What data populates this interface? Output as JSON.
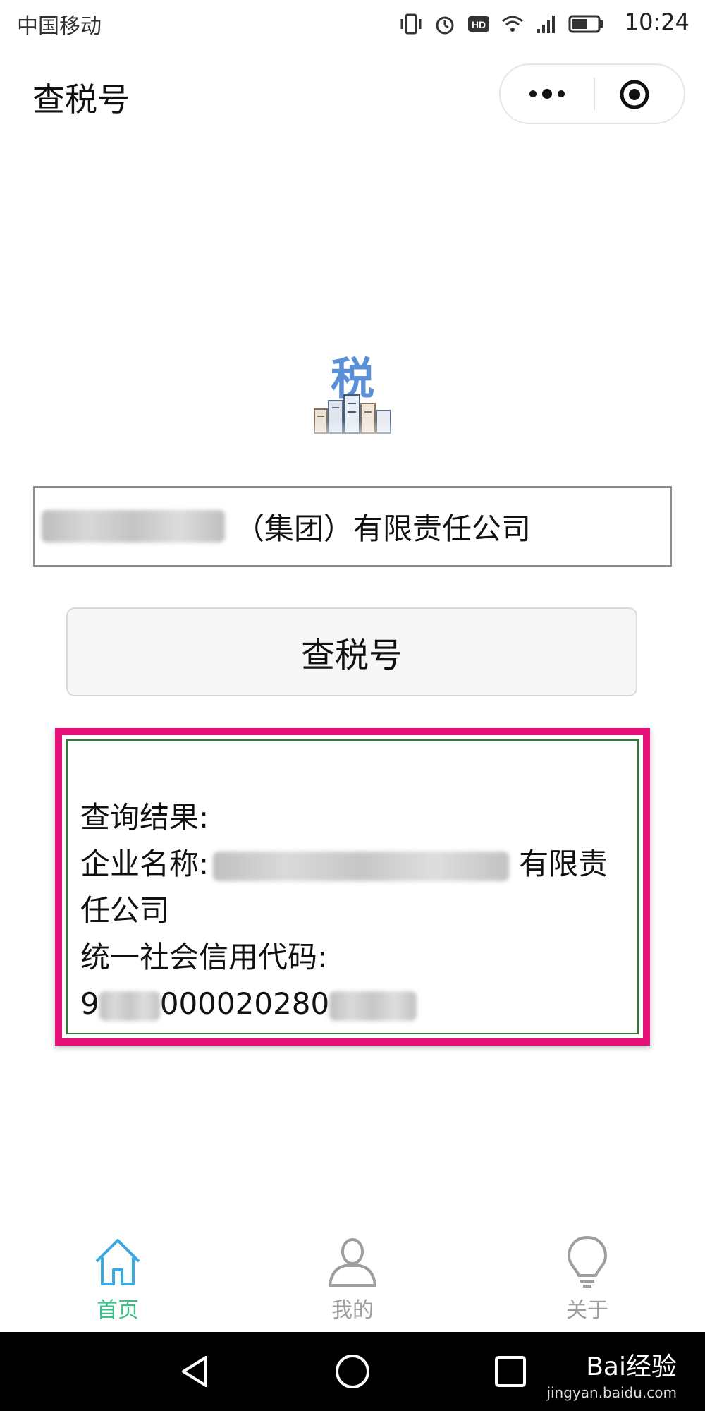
{
  "status_bar": {
    "carrier": "中国移动",
    "time": "10:24"
  },
  "nav": {
    "title": "查税号"
  },
  "search": {
    "value": "（集团）有限责任公司"
  },
  "query_button": {
    "label": "查税号"
  },
  "result": {
    "heading": "查询结果:",
    "name_label": "企业名称:",
    "name_suffix": "有限责",
    "name_cont": "任公司",
    "code_label": "统一社会信用代码:",
    "code_prefix": "9",
    "code_middle": "000020280"
  },
  "tabs": [
    {
      "label": "首页",
      "icon": "home-icon",
      "active": true
    },
    {
      "label": "我的",
      "icon": "user-icon",
      "active": false
    },
    {
      "label": "关于",
      "icon": "lightbulb-icon",
      "active": false
    }
  ],
  "watermark": {
    "brand": "Bai经验",
    "url": "jingyan.baidu.com"
  },
  "colors": {
    "accent": "#3cc08a",
    "highlight": "#e5107a",
    "result_border": "#2e7d32"
  }
}
